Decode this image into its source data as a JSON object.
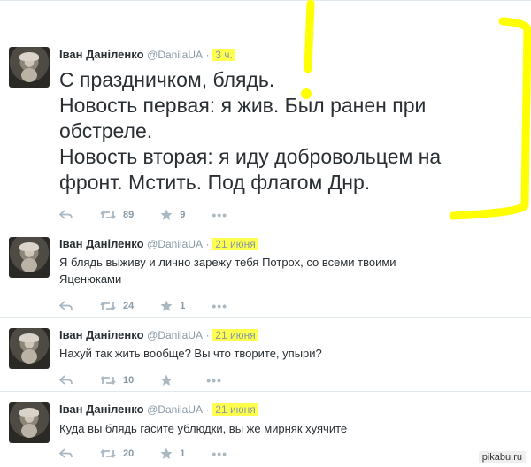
{
  "tweets": [
    {
      "author": "Іван Даніленко",
      "handle": "@DanilaUA",
      "separator": "·",
      "time": "3 ч.",
      "lines": [
        "С праздничком, блядь.",
        "Новость первая: я жив. Был ранен при",
        "обстреле.",
        "Новость вторая: я иду добровольцем на",
        "фронт. Мстить. Под флагом Днр."
      ],
      "retweets": "89",
      "favorites": "9"
    },
    {
      "author": "Іван Даніленко",
      "handle": "@DanilaUA",
      "separator": "·",
      "time": "21 июня",
      "lines": [
        "Я блядь выживу и лично зарежу тебя Потрох, со всеми твоими",
        "Яценюками"
      ],
      "retweets": "24",
      "favorites": "1"
    },
    {
      "author": "Іван Даніленко",
      "handle": "@DanilaUA",
      "separator": "·",
      "time": "21 июня",
      "lines": [
        "Нахуй так жить вообще? Вы что творите, упыри?"
      ],
      "retweets": "10",
      "favorites": ""
    },
    {
      "author": "Іван Даніленко",
      "handle": "@DanilaUA",
      "separator": "·",
      "time": "21 июня",
      "lines": [
        "Куда вы блядь гасите ублюдки, вы же мирняк хуячите"
      ],
      "retweets": "20",
      "favorites": "1"
    }
  ],
  "more_icon": "•••",
  "watermark": "pikabu.ru",
  "colors": {
    "highlight": "#ffff4d",
    "annotation": "#ffff00",
    "muted": "#8899a6",
    "text": "#292f33"
  }
}
